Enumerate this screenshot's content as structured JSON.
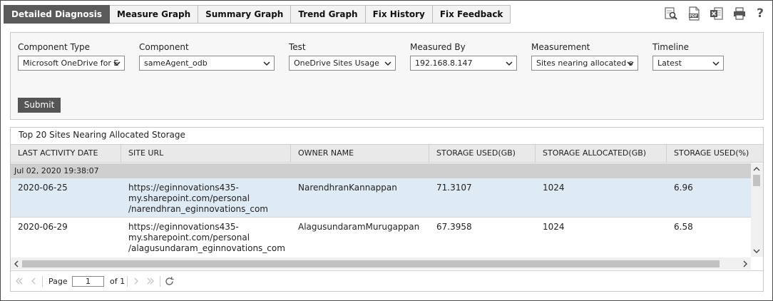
{
  "tabs": [
    {
      "label": "Detailed Diagnosis",
      "active": true
    },
    {
      "label": "Measure Graph",
      "active": false
    },
    {
      "label": "Summary Graph",
      "active": false
    },
    {
      "label": "Trend Graph",
      "active": false
    },
    {
      "label": "Fix History",
      "active": false
    },
    {
      "label": "Fix Feedback",
      "active": false
    }
  ],
  "toolbar": {
    "icons": [
      "search-report-icon",
      "pdf-icon",
      "excel-icon",
      "print-icon",
      "help-icon"
    ],
    "pdf_text": "PDF",
    "help_text": "?"
  },
  "filters": {
    "component_type": {
      "label": "Component Type",
      "value": "Microsoft OneDrive for E"
    },
    "component": {
      "label": "Component",
      "value": "sameAgent_odb"
    },
    "test": {
      "label": "Test",
      "value": "OneDrive Sites Usage"
    },
    "measured_by": {
      "label": "Measured By",
      "value": "192.168.8.147"
    },
    "measurement": {
      "label": "Measurement",
      "value": "Sites nearing allocated s"
    },
    "timeline": {
      "label": "Timeline",
      "value": "Latest"
    },
    "submit_label": "Submit"
  },
  "table": {
    "title": "Top 20 Sites Nearing Allocated Storage",
    "columns": [
      "LAST ACTIVITY DATE",
      "SITE URL",
      "OWNER NAME",
      "STORAGE USED(GB)",
      "STORAGE ALLOCATED(GB)",
      "STORAGE USED(%)"
    ],
    "group_label": "Jul 02, 2020 19:38:07",
    "rows": [
      {
        "date": "2020-06-25",
        "url_lines": [
          "https://eginnovations435-",
          "my.sharepoint.com/personal",
          "/narendhran_eginnovations_com"
        ],
        "owner": "NarendhranKannappan",
        "used_gb": "71.3107",
        "allocated_gb": "1024",
        "used_pct": "6.96",
        "selected": true
      },
      {
        "date": "2020-06-29",
        "url_lines": [
          "https://eginnovations435-",
          "my.sharepoint.com/personal",
          "/alagusundaram_eginnovations_com"
        ],
        "owner": "AlagusundaramMurugappan",
        "used_gb": "67.3958",
        "allocated_gb": "1024",
        "used_pct": "6.58",
        "selected": false
      }
    ]
  },
  "pager": {
    "page_label": "Page",
    "current_page": "1",
    "of_label": "of 1"
  },
  "colors": {
    "active_tab": "#5a5a5a",
    "selected_row": "#deeaf4",
    "group_row": "#cfcfcf",
    "header_row": "#e9e9e9"
  }
}
